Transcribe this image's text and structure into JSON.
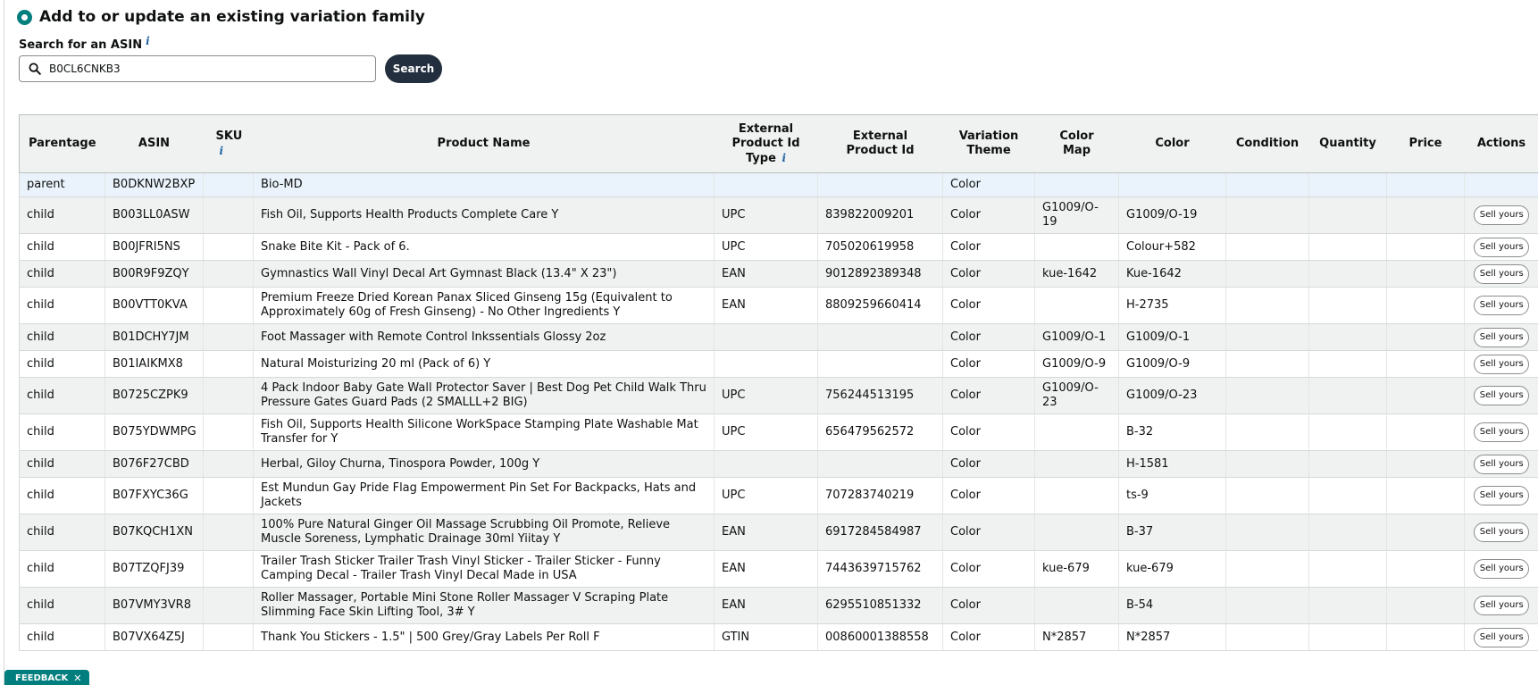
{
  "section": {
    "title": "Add to or update an existing variation family"
  },
  "search": {
    "label": "Search for an ASIN",
    "info_icon": "i",
    "value": "B0CL6CNKB3",
    "button_label": "Search"
  },
  "table": {
    "headers": {
      "parentage": "Parentage",
      "asin": "ASIN",
      "sku": "SKU",
      "sku_info": "i",
      "product_name": "Product Name",
      "ext_id_type": "External Product Id Type",
      "ext_id_type_info": "i",
      "ext_id": "External Product Id",
      "variation_theme": "Variation Theme",
      "color_map": "Color Map",
      "color": "Color",
      "condition": "Condition",
      "quantity": "Quantity",
      "price": "Price",
      "actions": "Actions"
    },
    "sell_label": "Sell yours",
    "rows": [
      {
        "parentage": "parent",
        "asin": "B0DKNW2BXP",
        "sku": "",
        "product_name": "Bio-MD",
        "ext_id_type": "",
        "ext_id": "",
        "variation_theme": "Color",
        "color_map": "",
        "color": "",
        "condition": "",
        "quantity": "",
        "price": ""
      },
      {
        "parentage": "child",
        "asin": "B003LL0ASW",
        "sku": "",
        "product_name": "Fish Oil, Supports Health Products Complete Care Y",
        "ext_id_type": "UPC",
        "ext_id": "839822009201",
        "variation_theme": "Color",
        "color_map": "G1009/O-19",
        "color": "G1009/O-19",
        "condition": "",
        "quantity": "",
        "price": ""
      },
      {
        "parentage": "child",
        "asin": "B00JFRI5NS",
        "sku": "",
        "product_name": "Snake Bite Kit - Pack of 6.",
        "ext_id_type": "UPC",
        "ext_id": "705020619958",
        "variation_theme": "Color",
        "color_map": "",
        "color": "Colour+582",
        "condition": "",
        "quantity": "",
        "price": ""
      },
      {
        "parentage": "child",
        "asin": "B00R9F9ZQY",
        "sku": "",
        "product_name": "Gymnastics Wall Vinyl Decal Art Gymnast Black (13.4\" X 23\")",
        "ext_id_type": "EAN",
        "ext_id": "9012892389348",
        "variation_theme": "Color",
        "color_map": "kue-1642",
        "color": "Kue-1642",
        "condition": "",
        "quantity": "",
        "price": ""
      },
      {
        "parentage": "child",
        "asin": "B00VTT0KVA",
        "sku": "",
        "product_name": "Premium Freeze Dried Korean Panax Sliced Ginseng 15g (Equivalent to Approximately 60g of Fresh Ginseng) - No Other Ingredients Y",
        "ext_id_type": "EAN",
        "ext_id": "8809259660414",
        "variation_theme": "Color",
        "color_map": "",
        "color": "H-2735",
        "condition": "",
        "quantity": "",
        "price": ""
      },
      {
        "parentage": "child",
        "asin": "B01DCHY7JM",
        "sku": "",
        "product_name": "Foot Massager with Remote Control Inkssentials Glossy 2oz",
        "ext_id_type": "",
        "ext_id": "",
        "variation_theme": "Color",
        "color_map": "G1009/O-1",
        "color": "G1009/O-1",
        "condition": "",
        "quantity": "",
        "price": ""
      },
      {
        "parentage": "child",
        "asin": "B01IAIKMX8",
        "sku": "",
        "product_name": "Natural Moisturizing 20 ml (Pack of 6) Y",
        "ext_id_type": "",
        "ext_id": "",
        "variation_theme": "Color",
        "color_map": "G1009/O-9",
        "color": "G1009/O-9",
        "condition": "",
        "quantity": "",
        "price": ""
      },
      {
        "parentage": "child",
        "asin": "B0725CZPK9",
        "sku": "",
        "product_name": "4 Pack Indoor Baby Gate Wall Protector Saver | Best Dog Pet Child Walk Thru Pressure Gates Guard Pads (2 SMALLL+2 BIG)",
        "ext_id_type": "UPC",
        "ext_id": "756244513195",
        "variation_theme": "Color",
        "color_map": "G1009/O-23",
        "color": "G1009/O-23",
        "condition": "",
        "quantity": "",
        "price": ""
      },
      {
        "parentage": "child",
        "asin": "B075YDWMPG",
        "sku": "",
        "product_name": "Fish Oil, Supports Health Silicone WorkSpace Stamping Plate Washable Mat Transfer for Y",
        "ext_id_type": "UPC",
        "ext_id": "656479562572",
        "variation_theme": "Color",
        "color_map": "",
        "color": "B-32",
        "condition": "",
        "quantity": "",
        "price": ""
      },
      {
        "parentage": "child",
        "asin": "B076F27CBD",
        "sku": "",
        "product_name": "Herbal, Giloy Churna, Tinospora Powder, 100g Y",
        "ext_id_type": "",
        "ext_id": "",
        "variation_theme": "Color",
        "color_map": "",
        "color": "H-1581",
        "condition": "",
        "quantity": "",
        "price": ""
      },
      {
        "parentage": "child",
        "asin": "B07FXYC36G",
        "sku": "",
        "product_name": "Est Mundun Gay Pride Flag Empowerment Pin Set For Backpacks, Hats and Jackets",
        "ext_id_type": "UPC",
        "ext_id": "707283740219",
        "variation_theme": "Color",
        "color_map": "",
        "color": "ts-9",
        "condition": "",
        "quantity": "",
        "price": ""
      },
      {
        "parentage": "child",
        "asin": "B07KQCH1XN",
        "sku": "",
        "product_name": "100% Pure Natural Ginger Oil Massage Scrubbing Oil Promote, Relieve Muscle Soreness, Lymphatic Drainage 30ml Yiitay Y",
        "ext_id_type": "EAN",
        "ext_id": "6917284584987",
        "variation_theme": "Color",
        "color_map": "",
        "color": "B-37",
        "condition": "",
        "quantity": "",
        "price": ""
      },
      {
        "parentage": "child",
        "asin": "B07TZQFJ39",
        "sku": "",
        "product_name": "Trailer Trash Sticker Trailer Trash Vinyl Sticker - Trailer Sticker - Funny Camping Decal - Trailer Trash Vinyl Decal Made in USA",
        "ext_id_type": "EAN",
        "ext_id": "7443639715762",
        "variation_theme": "Color",
        "color_map": "kue-679",
        "color": "kue-679",
        "condition": "",
        "quantity": "",
        "price": ""
      },
      {
        "parentage": "child",
        "asin": "B07VMY3VR8",
        "sku": "",
        "product_name": "Roller Massager, Portable Mini Stone Roller Massager V Scraping Plate Slimming Face Skin Lifting Tool, 3# Y",
        "ext_id_type": "EAN",
        "ext_id": "6295510851332",
        "variation_theme": "Color",
        "color_map": "",
        "color": "B-54",
        "condition": "",
        "quantity": "",
        "price": ""
      },
      {
        "parentage": "child",
        "asin": "B07VX64Z5J",
        "sku": "",
        "product_name": "Thank You Stickers - 1.5\" | 500 Grey/Gray Labels Per Roll F",
        "ext_id_type": "GTIN",
        "ext_id": "00860001388558",
        "variation_theme": "Color",
        "color_map": "N*2857",
        "color": "N*2857",
        "condition": "",
        "quantity": "",
        "price": ""
      }
    ]
  },
  "feedback": {
    "label": "FEEDBACK",
    "close": "✕"
  }
}
